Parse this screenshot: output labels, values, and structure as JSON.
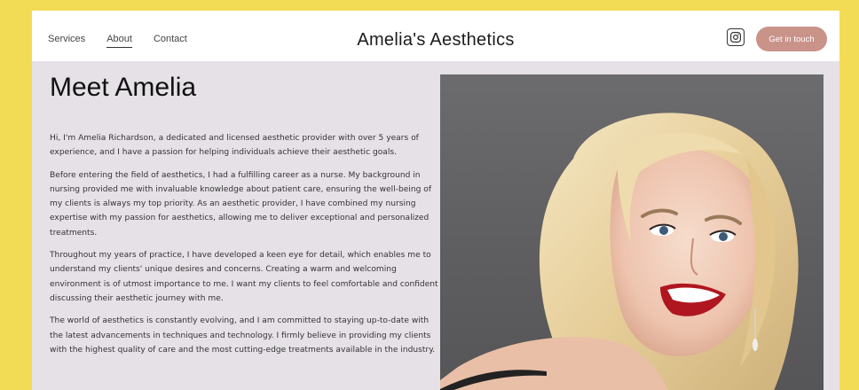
{
  "nav": {
    "items": [
      {
        "label": "Services"
      },
      {
        "label": "About"
      },
      {
        "label": "Contact"
      }
    ]
  },
  "brand": {
    "name": "Amelia's Aesthetics"
  },
  "header": {
    "social_icon": "instagram-icon",
    "cta_label": "Get in touch"
  },
  "about": {
    "title": "Meet Amelia",
    "paragraphs": [
      "Hi, I'm Amelia Richardson, a dedicated and licensed aesthetic provider with over 5 years of experience, and I have a passion for helping individuals achieve their aesthetic goals.",
      "Before entering the field of aesthetics, I had a fulfilling career as a nurse. My background in nursing provided me with invaluable knowledge about patient care, ensuring the well-being of my clients is always my top priority. As an aesthetic provider, I have combined my nursing expertise with my passion for aesthetics, allowing me to deliver exceptional and personalized treatments.",
      "Throughout my years of practice, I have developed a keen eye for detail, which enables me to understand my clients' unique desires and concerns. Creating a warm and welcoming environment is of utmost importance to me. I want my clients to feel comfortable and confident discussing their aesthetic journey with me.",
      "The world of aesthetics is constantly evolving, and I am committed to staying up-to-date with the latest advancements in techniques and technology. I firmly believe in providing my clients with the highest quality of care and the most cutting-edge treatments available in the industry."
    ]
  },
  "colors": {
    "page_background": "#f3dc55",
    "accent": "#c9938a",
    "content_background": "#e6e1e7"
  }
}
